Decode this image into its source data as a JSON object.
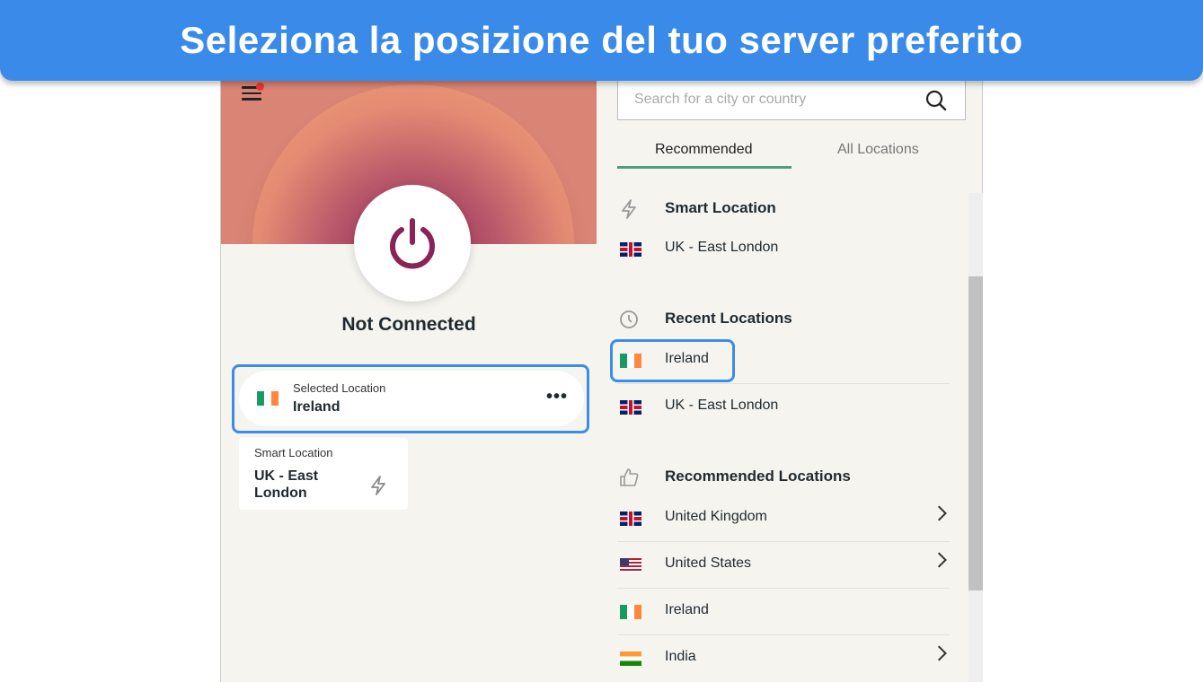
{
  "banner": {
    "title": "Seleziona la posizione del tuo server preferito"
  },
  "left": {
    "status": "Not Connected",
    "selected": {
      "caption": "Selected Location",
      "name": "Ireland",
      "flag": "ireland"
    },
    "smart": {
      "caption": "Smart Location",
      "name_line1": "UK - East",
      "name_line2": "London",
      "icon": "bolt-icon"
    }
  },
  "right": {
    "search_placeholder": "Search for a city or country",
    "tabs": [
      {
        "label": "Recommended",
        "active": true
      },
      {
        "label": "All Locations",
        "active": false
      }
    ],
    "smart_header": "Smart Location",
    "smart_item": "UK - East London",
    "recent_header": "Recent Locations",
    "recent": [
      "Ireland",
      "UK - East London"
    ],
    "recommended_header": "Recommended Locations",
    "recommended": [
      "United Kingdom",
      "United States",
      "Ireland",
      "India"
    ]
  },
  "colors": {
    "accent": "#3a8be9",
    "tab_underline": "#4c9e7e",
    "power": "#8a2357"
  }
}
